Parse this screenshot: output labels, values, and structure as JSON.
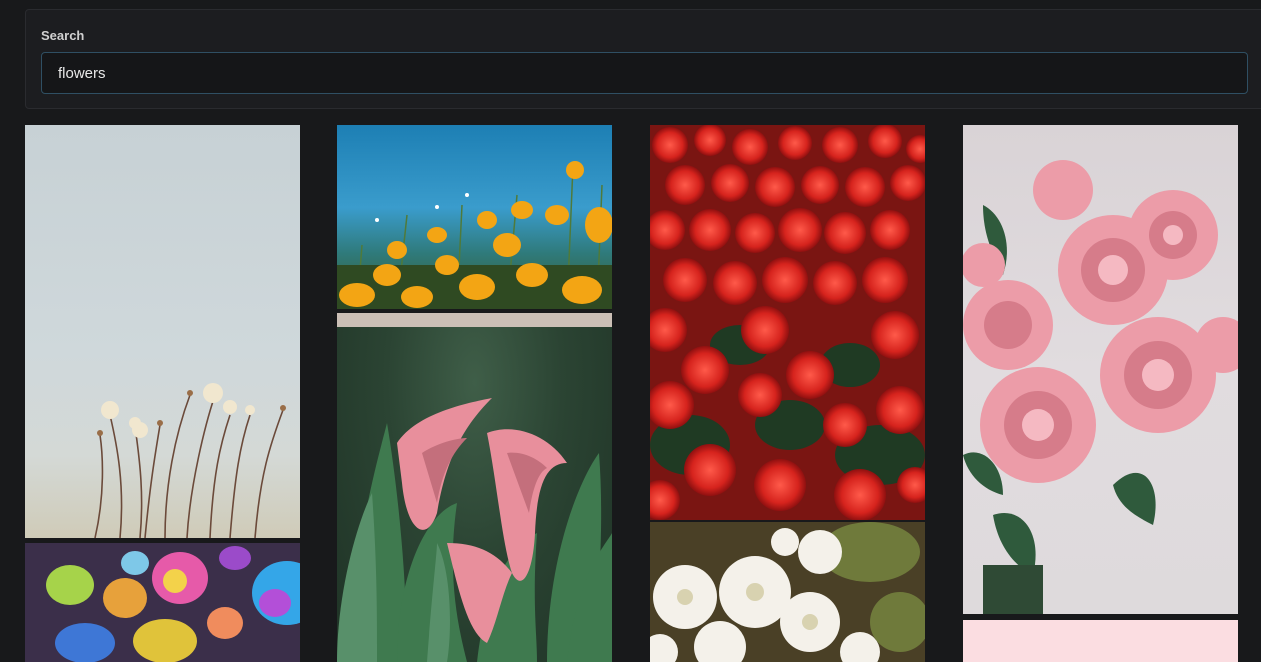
{
  "search": {
    "label": "Search",
    "value": "flowers"
  },
  "gallery": {
    "items": [
      {
        "name": "wildflowers-photo"
      },
      {
        "name": "rainbow-roses-photo"
      },
      {
        "name": "yellow-poppies-photo"
      },
      {
        "name": "calla-lilies-photo"
      },
      {
        "name": "red-flowers-photo"
      },
      {
        "name": "white-chrysanthemums-photo"
      },
      {
        "name": "pink-roses-photo"
      },
      {
        "name": "pink-blank-photo"
      }
    ]
  },
  "colors": {
    "background": "#18191b",
    "panel": "#1c1d20",
    "input_border": "#2f4f63"
  }
}
